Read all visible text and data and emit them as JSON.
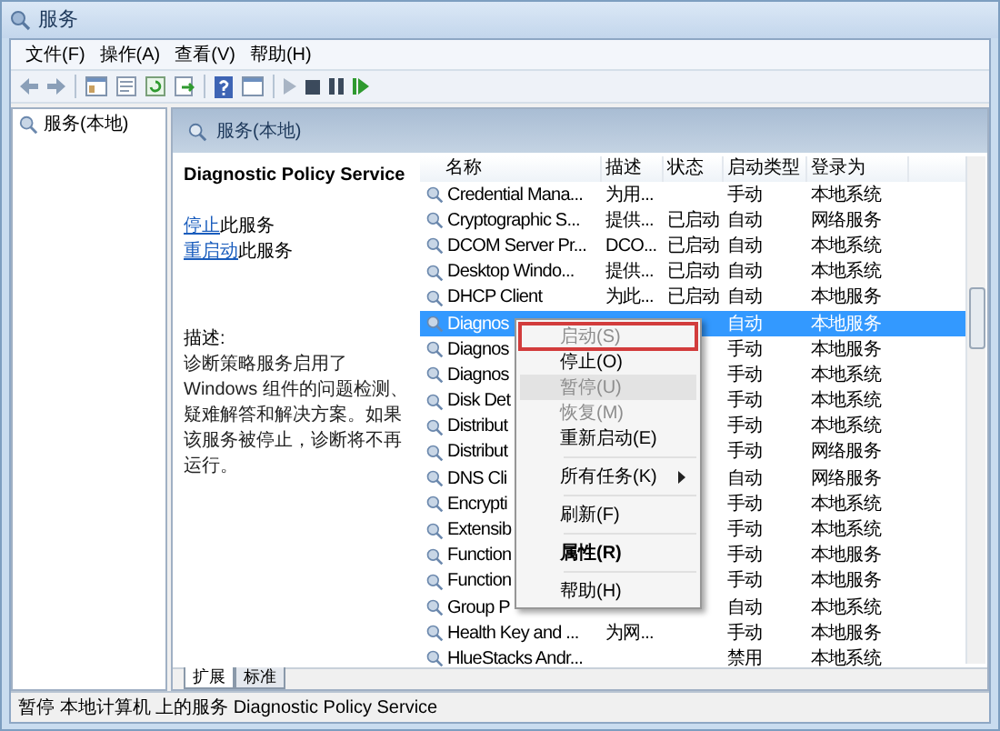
{
  "window": {
    "title": "服务"
  },
  "menu": [
    "文件(F)",
    "操作(A)",
    "查看(V)",
    "帮助(H)"
  ],
  "tree": {
    "items": [
      {
        "label": "服务(本地)",
        "selected": false
      }
    ]
  },
  "panel": {
    "header": "服务(本地)"
  },
  "detail": {
    "title": "Diagnostic Policy Service",
    "actions": [
      {
        "link": "停止",
        "text": "此服务"
      },
      {
        "link": "重启动",
        "text": "此服务"
      }
    ],
    "description_label": "描述:",
    "description": "诊断策略服务启用了 Windows 组件的问题检测、疑难解答和解决方案。如果该服务被停止，诊断将不再运行。"
  },
  "table": {
    "columns": [
      "名称",
      "描述",
      "状态",
      "启动类型",
      "登录为"
    ],
    "rows": [
      {
        "name": "Credential Mana...",
        "description": "为用...",
        "startup": "手动",
        "logon": "本地系统",
        "selected": false
      },
      {
        "name": "Cryptographic S...",
        "description": "提供...",
        "status": "已启动",
        "startup": "自动",
        "logon": "网络服务",
        "selected": false
      },
      {
        "name": "DCOM Server Pr...",
        "description": "DCO...",
        "status": "已启动",
        "startup": "自动",
        "logon": "本地系统",
        "selected": false
      },
      {
        "name": "Desktop Windo...",
        "description": "提供...",
        "status": "已启动",
        "startup": "自动",
        "logon": "本地系统",
        "selected": false
      },
      {
        "name": "DHCP Client",
        "description": "为此...",
        "status": "已启动",
        "startup": "自动",
        "logon": "本地服务",
        "selected": false
      },
      {
        "name": "Diagnos",
        "startup": "自动",
        "logon": "本地服务",
        "selected": true
      },
      {
        "name": "Diagnos",
        "startup": "手动",
        "logon": "本地服务",
        "selected": false
      },
      {
        "name": "Diagnos",
        "startup": "手动",
        "logon": "本地系统",
        "selected": false
      },
      {
        "name": "Disk Det",
        "startup": "手动",
        "logon": "本地系统",
        "selected": false
      },
      {
        "name": "Distribut",
        "startup": "手动",
        "logon": "本地系统",
        "selected": false
      },
      {
        "name": "Distribut",
        "startup": "手动",
        "logon": "网络服务",
        "selected": false
      },
      {
        "name": "DNS Cli",
        "startup": "自动",
        "logon": "网络服务",
        "selected": false
      },
      {
        "name": "Encrypti",
        "startup": "手动",
        "logon": "本地系统",
        "selected": false
      },
      {
        "name": "Extensib",
        "startup": "手动",
        "logon": "本地系统",
        "selected": false
      },
      {
        "name": "Function",
        "startup": "手动",
        "logon": "本地服务",
        "selected": false
      },
      {
        "name": "Function",
        "startup": "手动",
        "logon": "本地服务",
        "selected": false
      },
      {
        "name": "Group P",
        "startup": "自动",
        "logon": "本地系统",
        "selected": false
      },
      {
        "name": "Health Key and ...",
        "description": "为网...",
        "startup": "手动",
        "logon": "本地服务",
        "selected": false
      },
      {
        "name": "HlueStacks Andr...",
        "startup": "禁用",
        "logon": "本地系统",
        "selected": false
      }
    ]
  },
  "context_menu": {
    "items": [
      {
        "kind": "item",
        "label": "启动(S)",
        "disabled": true,
        "bold": false,
        "hovered": false,
        "outlined": true
      },
      {
        "kind": "item",
        "label": "停止(O)",
        "disabled": false,
        "bold": false,
        "hovered": false,
        "outlined": false
      },
      {
        "kind": "item",
        "label": "暂停(U)",
        "disabled": true,
        "bold": false,
        "hovered": true,
        "outlined": false
      },
      {
        "kind": "item",
        "label": "恢复(M)",
        "disabled": true,
        "bold": false,
        "hovered": false,
        "outlined": false
      },
      {
        "kind": "item",
        "label": "重新启动(E)",
        "disabled": false,
        "bold": false,
        "hovered": false,
        "outlined": false
      },
      {
        "kind": "separator"
      },
      {
        "kind": "submenu",
        "label": "所有任务(K)",
        "disabled": false,
        "bold": false,
        "hovered": false,
        "outlined": false
      },
      {
        "kind": "separator"
      },
      {
        "kind": "item",
        "label": "刷新(F)",
        "disabled": false,
        "bold": false,
        "hovered": false,
        "outlined": false
      },
      {
        "kind": "separator"
      },
      {
        "kind": "item",
        "label": "属性(R)",
        "disabled": false,
        "bold": true,
        "hovered": false,
        "outlined": false
      },
      {
        "kind": "separator"
      },
      {
        "kind": "item",
        "label": "帮助(H)",
        "disabled": false,
        "bold": false,
        "hovered": false,
        "outlined": false
      }
    ]
  },
  "tabs": [
    {
      "label": "扩展",
      "selected": true
    },
    {
      "label": "标准",
      "selected": false
    }
  ],
  "status_bar": "暂停 本地计算机 上的服务 Diagnostic Policy Service"
}
